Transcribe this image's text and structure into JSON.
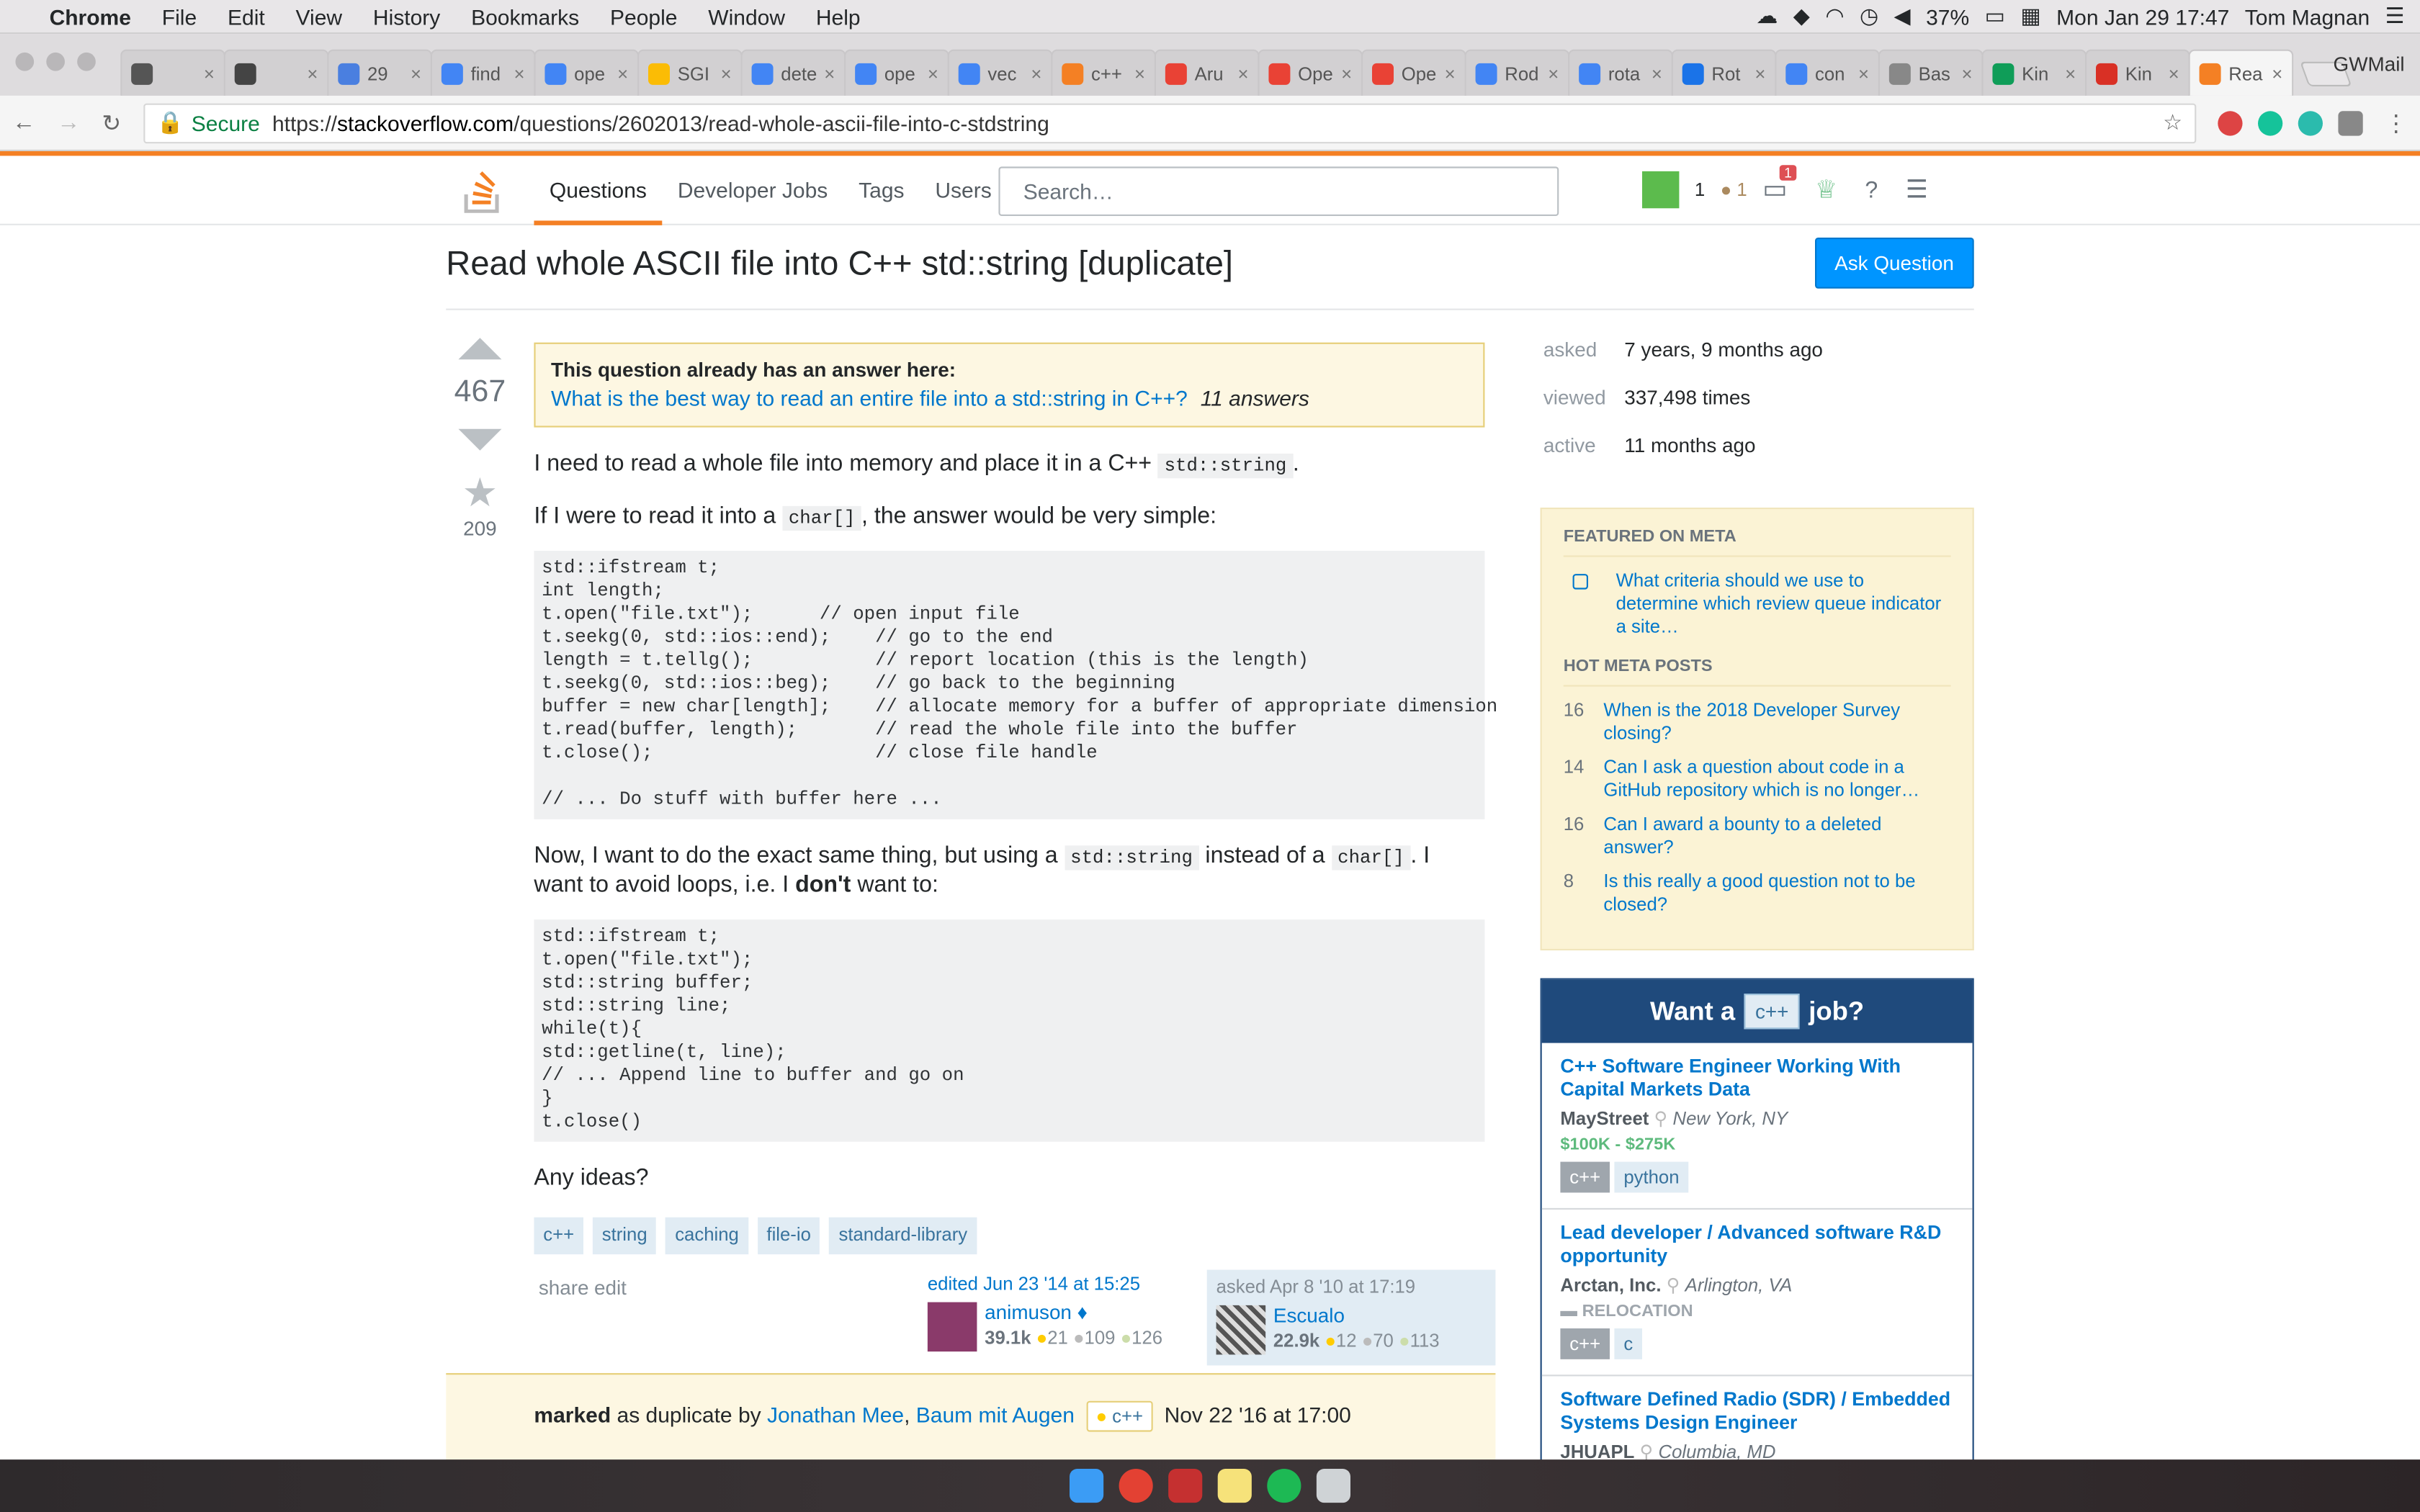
{
  "mac": {
    "app": "Chrome",
    "menus": [
      "File",
      "Edit",
      "View",
      "History",
      "Bookmarks",
      "People",
      "Window",
      "Help"
    ],
    "battery": "37%",
    "datetime": "Mon Jan 29 17:47",
    "user": "Tom Magnan"
  },
  "tabs": [
    "",
    "",
    "29",
    "find",
    "ope",
    "SGI",
    "dete",
    "ope",
    "vec",
    "c++",
    "Aru",
    "Ope",
    "Ope",
    "Rod",
    "rota",
    "Rot",
    "con",
    "Bas",
    "Kin",
    "Kin",
    "Rea"
  ],
  "tabbar_profile": "GWMail",
  "address": {
    "secure": "Secure",
    "scheme": "https://",
    "host": "stackoverflow.com",
    "path": "/questions/2602013/read-whole-ascii-file-into-c-stdstring"
  },
  "so_nav": {
    "items": [
      "Questions",
      "Developer Jobs",
      "Tags",
      "Users"
    ],
    "search_placeholder": "Search…",
    "rep": "1",
    "bronze": "1",
    "inbox_count": "1"
  },
  "question": {
    "title": "Read whole ASCII file into C++ std::string [duplicate]",
    "ask_button": "Ask Question",
    "votes": "467",
    "favorites": "209",
    "dupe_label": "This question already has an answer here:",
    "dupe_link": "What is the best way to read an entire file into a std::string in C++?",
    "dupe_answers": "11 answers",
    "p1_a": "I need to read a whole file into memory and place it in a C++ ",
    "p1_code": "std::string",
    "p1_b": ".",
    "p2_a": "If I were to read it into a ",
    "p2_code": "char[]",
    "p2_b": ", the answer would be very simple:",
    "code1": "std::ifstream t;\nint length;\nt.open(\"file.txt\");      // open input file\nt.seekg(0, std::ios::end);    // go to the end\nlength = t.tellg();           // report location (this is the length)\nt.seekg(0, std::ios::beg);    // go back to the beginning\nbuffer = new char[length];    // allocate memory for a buffer of appropriate dimension\nt.read(buffer, length);       // read the whole file into the buffer\nt.close();                    // close file handle\n\n// ... Do stuff with buffer here ...",
    "p3_a": "Now, I want to do the exact same thing, but using a ",
    "p3_code1": "std::string",
    "p3_b": " instead of a ",
    "p3_code2": "char[]",
    "p3_c": ". I want to avoid loops, i.e. I ",
    "p3_bold": "don't",
    "p3_d": " want to:",
    "code2": "std::ifstream t;\nt.open(\"file.txt\");\nstd::string buffer;\nstd::string line;\nwhile(t){\nstd::getline(t, line);\n// ... Append line to buffer and go on\n}\nt.close()",
    "p4": "Any ideas?",
    "tags": [
      "c++",
      "string",
      "caching",
      "file-io",
      "standard-library"
    ],
    "share": "share",
    "edit": "edit",
    "edited_label": "edited Jun 23 '14 at 15:25",
    "editor": {
      "name": "animuson ♦",
      "rep": "39.1k",
      "gold": "21",
      "silver": "109",
      "bronze": "126"
    },
    "asked_label": "asked Apr 8 '10 at 17:19",
    "asker": {
      "name": "Escualo",
      "rep": "22.9k",
      "gold": "12",
      "silver": "70",
      "bronze": "113"
    }
  },
  "marked": {
    "word": "marked",
    "by": " as duplicate by ",
    "user1": "Jonathan Mee",
    "sep": ", ",
    "user2": "Baum mit Augen",
    "tag": "c++",
    "date": "Nov 22 '16 at 17:00"
  },
  "sidebar": {
    "stats": [
      {
        "label": "asked",
        "value": "7 years, 9 months ago"
      },
      {
        "label": "viewed",
        "value": "337,498 times"
      },
      {
        "label": "active",
        "value": "11 months ago"
      }
    ],
    "featured_heading": "FEATURED ON META",
    "featured": [
      {
        "text": "What criteria should we use to determine which review queue indicator a site…"
      }
    ],
    "hot_heading": "HOT META POSTS",
    "hot": [
      {
        "n": "16",
        "text": "When is the 2018 Developer Survey closing?"
      },
      {
        "n": "14",
        "text": "Can I ask a question about code in a GitHub repository which is no longer…"
      },
      {
        "n": "16",
        "text": "Can I award a bounty to a deleted answer?"
      },
      {
        "n": "8",
        "text": "Is this really a good question not to be closed?"
      }
    ],
    "jobs_want": "Want a",
    "jobs_tag": "c++",
    "jobs_q": "job?",
    "jobs": [
      {
        "title": "C++ Software Engineer Working With Capital Markets Data",
        "company": "MayStreet",
        "loc": "New York, NY",
        "salary": "$100K - $275K",
        "tags": [
          "c++",
          "python"
        ]
      },
      {
        "title": "Lead developer / Advanced software R&D opportunity",
        "company": "Arctan, Inc.",
        "loc": "Arlington, VA",
        "salary": "RELOCATION",
        "tags": [
          "c++",
          "c"
        ]
      },
      {
        "title": "Software Defined Radio (SDR) / Embedded Systems Design Engineer",
        "company": "JHUAPL",
        "loc": "Columbia, MD"
      }
    ]
  }
}
